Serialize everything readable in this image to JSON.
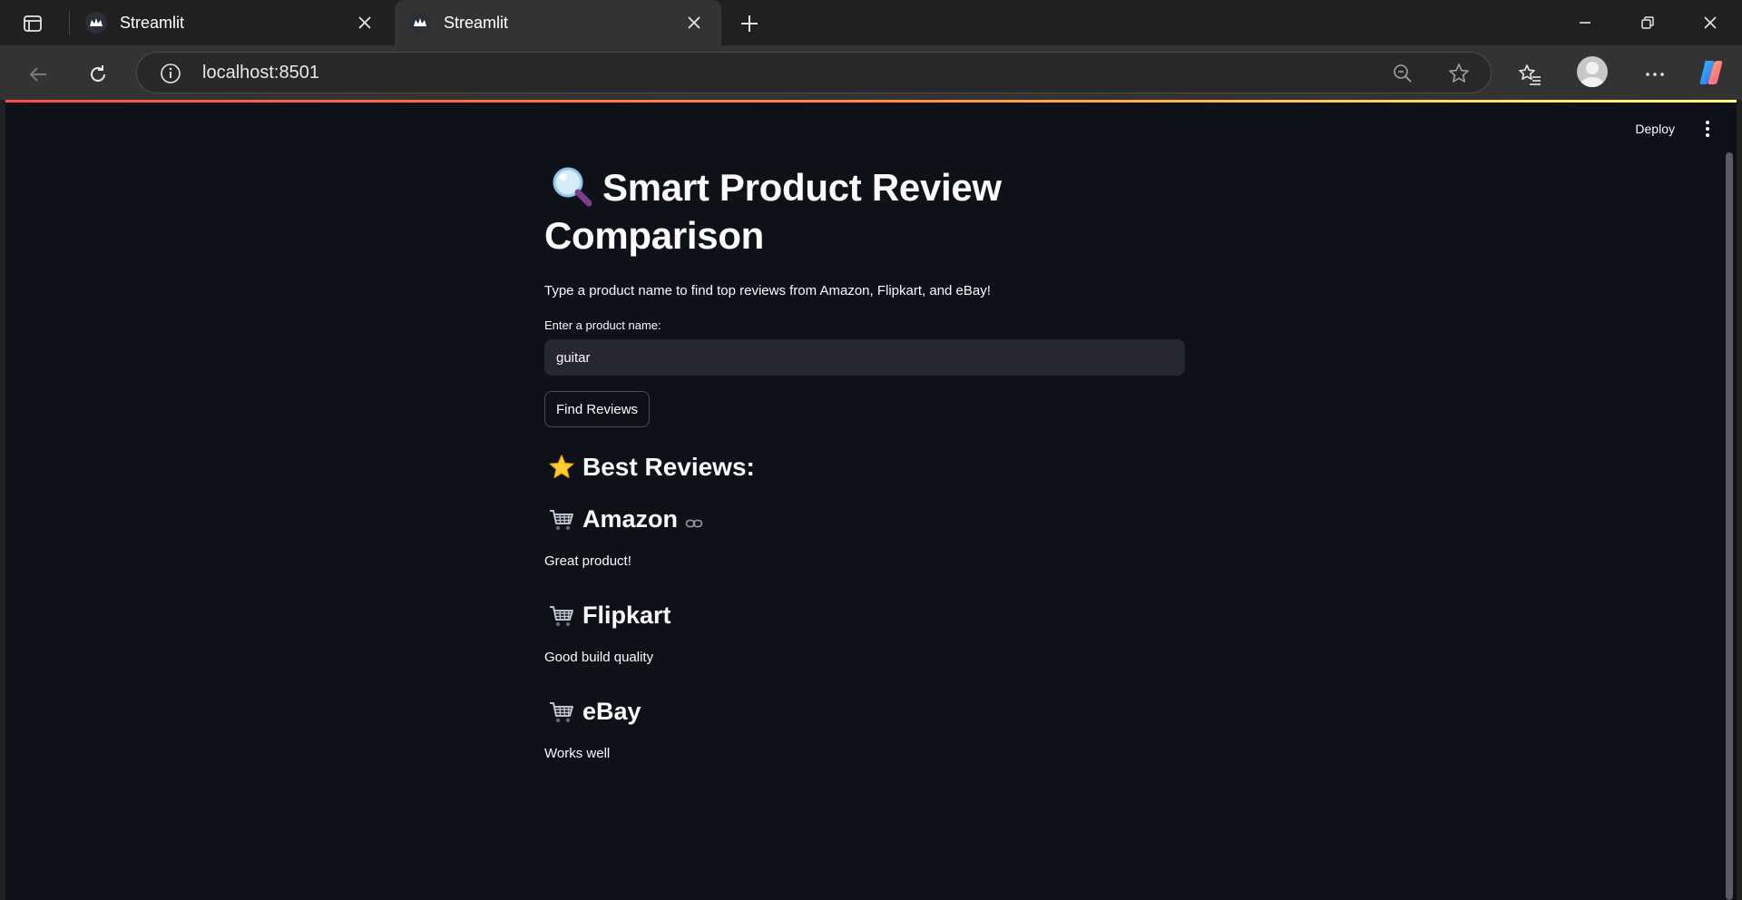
{
  "browser": {
    "tabs": [
      {
        "title": "Streamlit",
        "active": false
      },
      {
        "title": "Streamlit",
        "active": true
      }
    ],
    "url": "localhost:8501"
  },
  "app": {
    "deploy_label": "Deploy",
    "title": "Smart Product Review Comparison",
    "subtitle": "Type a product name to find top reviews from Amazon, Flipkart, and eBay!",
    "input_label": "Enter a product name:",
    "input_value": "guitar",
    "button_label": "Find Reviews",
    "best_heading": "Best Reviews:",
    "sources": [
      {
        "name": "Amazon",
        "review": "Great product!"
      },
      {
        "name": "Flipkart",
        "review": "Good build quality"
      },
      {
        "name": "eBay",
        "review": "Works well"
      }
    ]
  },
  "colors": {
    "app_background": "#0e1117",
    "input_background": "#262730",
    "text": "#fafafa",
    "accent": "#ff4b4b"
  },
  "icons": {
    "title": "magnifying-glass-icon",
    "best": "star-icon",
    "source": "shopping-cart-icon",
    "anchor": "link-icon"
  }
}
